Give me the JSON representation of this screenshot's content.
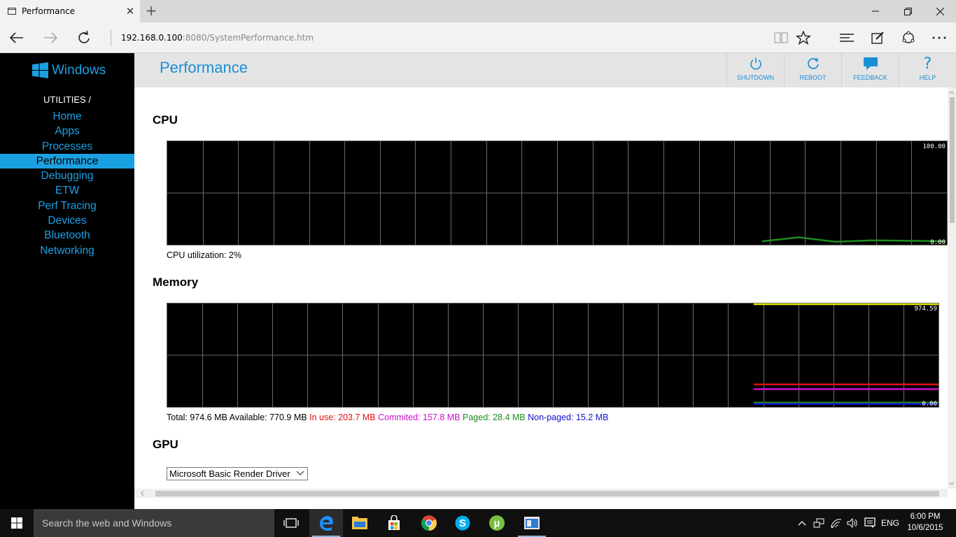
{
  "browser": {
    "tab_title": "Performance",
    "url_host": "192.168.0.100",
    "url_rest": ":8080/SystemPerformance.htm"
  },
  "sidebar": {
    "logo_text": "Windows",
    "section_heading": "UTILITIES /",
    "items": [
      {
        "label": "Home"
      },
      {
        "label": "Apps"
      },
      {
        "label": "Processes"
      },
      {
        "label": "Performance"
      },
      {
        "label": "Debugging"
      },
      {
        "label": "ETW"
      },
      {
        "label": "Perf Tracing"
      },
      {
        "label": "Devices"
      },
      {
        "label": "Bluetooth"
      },
      {
        "label": "Networking"
      }
    ],
    "active": "Performance"
  },
  "header": {
    "title": "Performance",
    "buttons": [
      {
        "label": "SHUTDOWN",
        "icon": "power-icon"
      },
      {
        "label": "REBOOT",
        "icon": "refresh-icon"
      },
      {
        "label": "FEEDBACK",
        "icon": "speech-bubble-icon"
      },
      {
        "label": "HELP",
        "icon": "question-icon"
      }
    ]
  },
  "cpu": {
    "title": "CPU",
    "caption": "CPU utilization: 2%",
    "max_label": "100.00",
    "min_label": "0.00",
    "series": [
      {
        "name": "CPU",
        "color": "#1e8c1e",
        "values": [
          2,
          6,
          1.5,
          3,
          2.5,
          2
        ]
      }
    ],
    "ylim": [
      0,
      100
    ]
  },
  "memory": {
    "title": "Memory",
    "max_label": "974.59",
    "min_label": "0.00",
    "ylim": [
      0,
      974.59
    ],
    "total": "Total: 974.6 MB",
    "available": "Available: 770.9 MB",
    "in_use": "In use: 203.7 MB",
    "committed": "Commited: 157.8 MB",
    "paged": "Paged: 28.4 MB",
    "non_paged": "Non-paged: 15.2 MB",
    "series": [
      {
        "name": "Total",
        "color": "#e8e800",
        "value": 974.6
      },
      {
        "name": "In use",
        "color": "#e01010",
        "value": 203.7
      },
      {
        "name": "Commited",
        "color": "#d010d0",
        "value": 157.8
      },
      {
        "name": "Paged",
        "color": "#1e8c1e",
        "value": 28.4
      },
      {
        "name": "Non-paged",
        "color": "#1010d0",
        "value": 15.2
      }
    ]
  },
  "gpu": {
    "title": "GPU",
    "selected_adapter": "Microsoft Basic Render Driver"
  },
  "taskbar": {
    "search_placeholder": "Search the web and Windows",
    "language": "ENG",
    "time": "6:00 PM",
    "date": "10/6/2015"
  }
}
